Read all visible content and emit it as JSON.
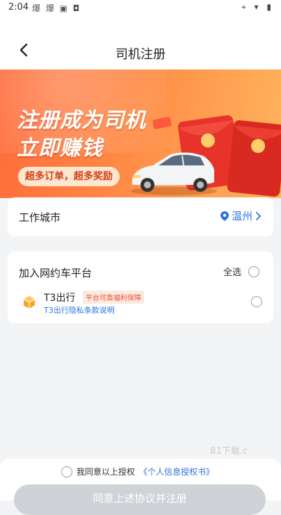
{
  "status": {
    "time": "2:04",
    "notif_icons": "爆 爆 ▣ ◘",
    "right_icons": "⌖ ▾ ▮"
  },
  "nav": {
    "title": "司机注册"
  },
  "banner": {
    "line1": "注册成为司机",
    "line2": "立即赚钱",
    "pill": "超多订单，超多奖励"
  },
  "city": {
    "label": "工作城市",
    "value": "温州"
  },
  "platforms": {
    "title": "加入网约车平台",
    "select_all": "全选",
    "items": [
      {
        "name": "T3出行",
        "badge": "平台可靠福利保障",
        "privacy": "T3出行隐私条款说明"
      }
    ]
  },
  "watermark": "81下载.c",
  "footer": {
    "agree_text": "我同意以上授权",
    "agree_link": "《个人信息授权书》",
    "submit": "同意上述协议并注册"
  },
  "colors": {
    "accent": "#2d72e0",
    "banner_orange": "#ff7a3d",
    "badge_red": "#e2562e"
  }
}
